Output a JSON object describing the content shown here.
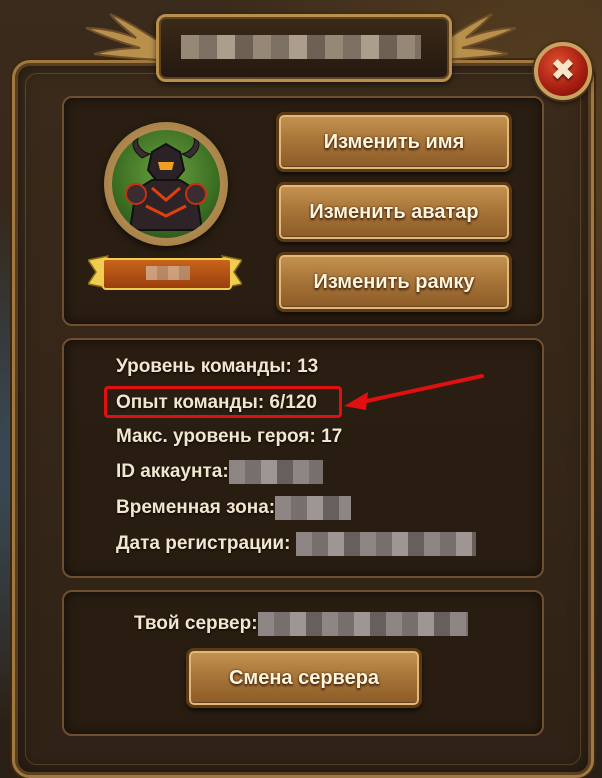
{
  "window": {
    "title": "",
    "close_label": "✖"
  },
  "profile": {
    "player_name": "",
    "avatar": "armored-hero-portrait"
  },
  "buttons": {
    "change_name": "Изменить имя",
    "change_avatar": "Изменить аватар",
    "change_frame": "Изменить рамку",
    "change_server": "Смена сервера"
  },
  "info": {
    "team_level_label": "Уровень команды:",
    "team_level_value": "13",
    "team_exp_label": "Опыт команды:",
    "team_exp_value": "6/120",
    "max_hero_level_label": "Макс. уровень героя:",
    "max_hero_level_value": "17",
    "account_id_label": "ID аккаунта:",
    "timezone_label": "Временная зона:",
    "registration_date_label": "Дата регистрации:"
  },
  "server": {
    "label": "Твой сервер:"
  },
  "colors": {
    "highlight": "#e01010",
    "button_gold": "#c69450",
    "text_cream": "#f3e6cf"
  }
}
